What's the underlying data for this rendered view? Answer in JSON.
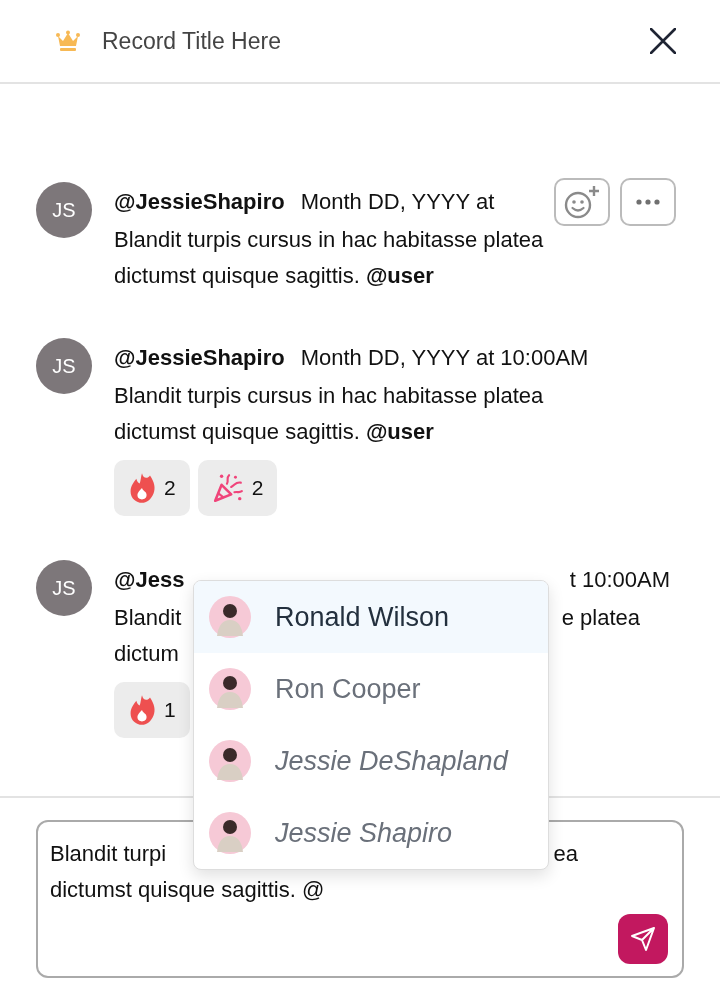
{
  "header": {
    "title": "Record Title Here"
  },
  "messages": [
    {
      "avatar": "JS",
      "author": "@JessieShapiro",
      "date": "Month DD, YYYY at",
      "covered": false,
      "hovered": true,
      "lines": [
        {
          "left": "Blandit turpis cursus in hac habitasse platea"
        },
        {
          "left": "dictumst quisque sagittis. **@user**"
        }
      ]
    },
    {
      "avatar": "JS",
      "author": "@JessieShapiro",
      "date": "Month DD, YYYY at 10:00AM",
      "covered": false,
      "hovered": false,
      "lines": [
        {
          "left": "Blandit turpis cursus in hac habitasse platea"
        },
        {
          "left": "dictumst quisque sagittis. **@user**"
        }
      ],
      "reactions": [
        {
          "kind": "fire",
          "count": "2"
        },
        {
          "kind": "party",
          "count": "2"
        }
      ]
    },
    {
      "avatar": "JS",
      "author": "@Jess",
      "date": "t 10:00AM",
      "covered": true,
      "hovered": false,
      "lines": [
        {
          "left": "Blandit",
          "right": "e platea"
        },
        {
          "left": "dictum"
        }
      ],
      "reactions": [
        {
          "kind": "fire",
          "count": "1"
        }
      ]
    }
  ],
  "mentions": [
    {
      "name": "Ronald Wilson",
      "selected": true,
      "kind": "member"
    },
    {
      "name": "Ron Cooper",
      "selected": false,
      "kind": "member"
    },
    {
      "name": "Jessie DeShapland",
      "selected": false,
      "kind": "guest"
    },
    {
      "name": "Jessie Shapiro",
      "selected": false,
      "kind": "guest"
    }
  ],
  "composer": {
    "lines": [
      {
        "left": "Blandit turpi",
        "right": "ea"
      },
      {
        "left": "dictumst quisque sagittis. @"
      }
    ]
  }
}
